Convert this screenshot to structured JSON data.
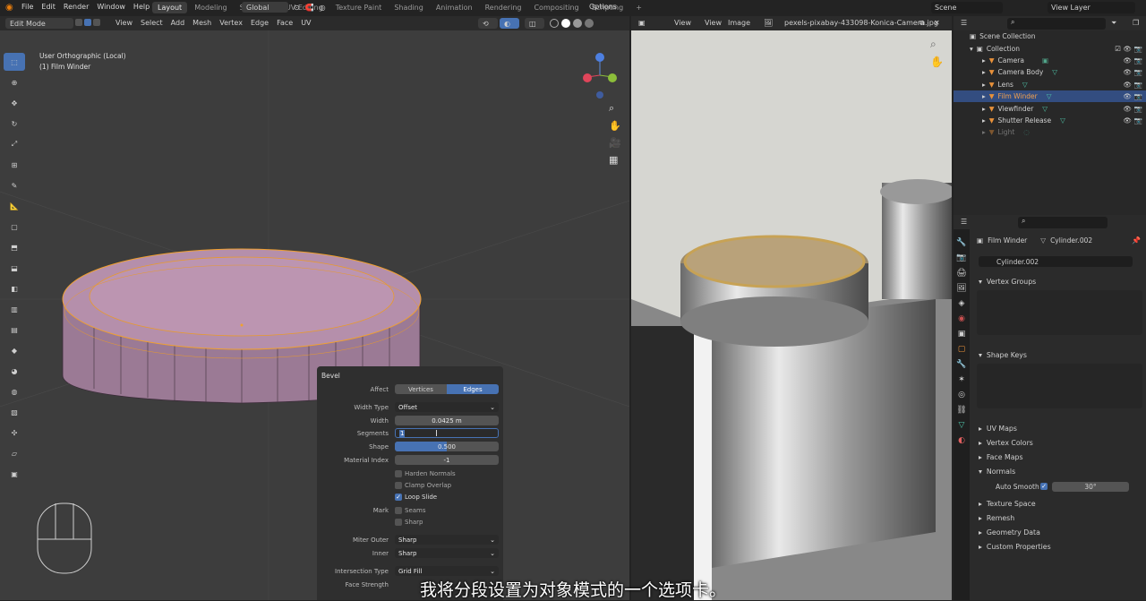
{
  "topbar": {
    "menus": [
      "File",
      "Edit",
      "Render",
      "Window",
      "Help"
    ],
    "workspaces": [
      "Layout",
      "Modeling",
      "Sculpting",
      "UV Editing",
      "Texture Paint",
      "Shading",
      "Animation",
      "Rendering",
      "Compositing",
      "Scripting"
    ],
    "active_workspace": "Layout",
    "scene": "Scene",
    "view_layer": "View Layer"
  },
  "vp_header": {
    "mode": "Edit Mode",
    "menus": [
      "View",
      "Select",
      "Add",
      "Mesh",
      "Vertex",
      "Edge",
      "Face",
      "UV"
    ],
    "orientation": "Global",
    "options": "Options"
  },
  "viewport": {
    "view_name": "User Orthographic (Local)",
    "object_name": "(1) Film Winder"
  },
  "image_editor": {
    "menus": [
      "View",
      "View",
      "Image"
    ],
    "filename": "pexels-pixabay-433098-Konica-Camera.jpg"
  },
  "outliner": {
    "root": "Scene Collection",
    "collection": "Collection",
    "items": [
      "Camera",
      "Camera Body",
      "Lens",
      "Film Winder",
      "Viewfinder",
      "Shutter Release",
      "Light"
    ],
    "selected": "Film Winder"
  },
  "properties": {
    "object": "Film Winder",
    "mesh": "Cylinder.002",
    "data_field": "Cylinder.002",
    "sections": [
      "Vertex Groups",
      "Shape Keys",
      "UV Maps",
      "Vertex Colors",
      "Face Maps",
      "Normals",
      "Texture Space",
      "Remesh",
      "Geometry Data",
      "Custom Properties"
    ],
    "auto_smooth_label": "Auto Smooth",
    "auto_smooth_angle": "30°"
  },
  "operator": {
    "title": "Bevel",
    "affect_label": "Affect",
    "affect_options": [
      "Vertices",
      "Edges"
    ],
    "affect_selected": "Edges",
    "width_type_label": "Width Type",
    "width_type": "Offset",
    "width_label": "Width",
    "width": "0.0425 m",
    "segments_label": "Segments",
    "segments": "1",
    "shape_label": "Shape",
    "shape": "0.500",
    "shape_fraction": 0.5,
    "material_index_label": "Material Index",
    "material_index": "-1",
    "harden_normals": "Harden Normals",
    "clamp_overlap": "Clamp Overlap",
    "loop_slide": "Loop Slide",
    "mark_label": "Mark",
    "seams": "Seams",
    "sharp": "Sharp",
    "miter_outer_label": "Miter Outer",
    "miter_outer": "Sharp",
    "inner_label": "Inner",
    "inner": "Sharp",
    "intersection_type_label": "Intersection Type",
    "intersection_type": "Grid Fill",
    "face_strength_label": "Face Strength"
  },
  "subtitle": "我将分段设置为对象模式的一个选项卡。"
}
